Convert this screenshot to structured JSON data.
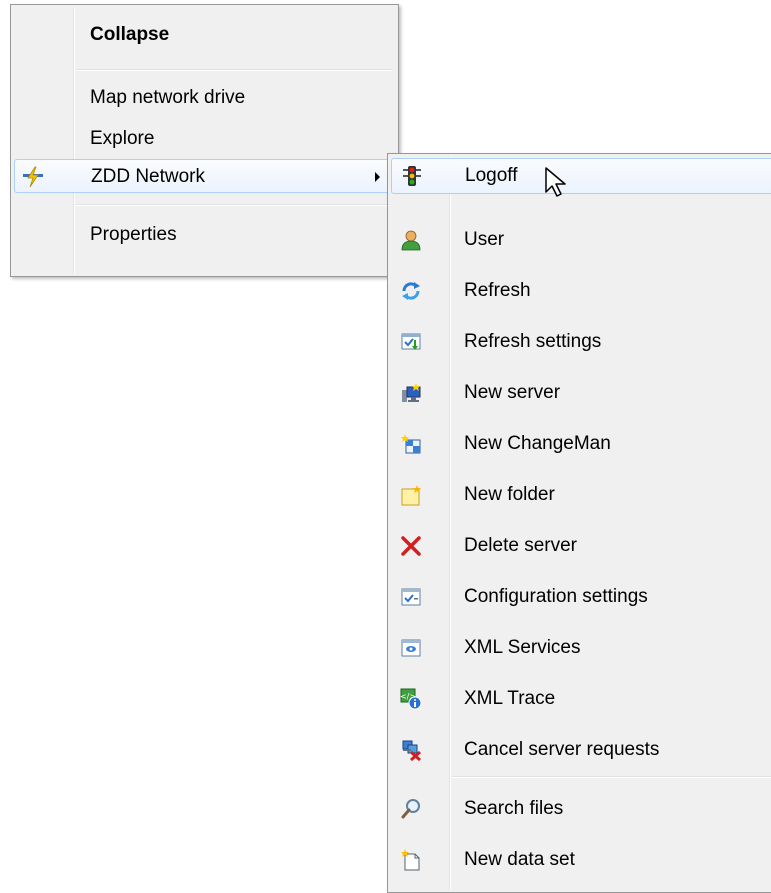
{
  "main_menu": {
    "items": [
      {
        "label": "Collapse",
        "bold": true
      },
      {
        "label": "Map network drive"
      },
      {
        "label": "Explore"
      },
      {
        "label": "ZDD Network",
        "icon": "zdd-network-icon",
        "submenu": true
      },
      {
        "label": "Properties"
      }
    ]
  },
  "sub_menu": {
    "items": [
      {
        "label": "Logoff",
        "icon": "traffic-light-icon",
        "highlighted": true
      },
      {
        "label": "User",
        "icon": "user-icon"
      },
      {
        "label": "Refresh",
        "icon": "refresh-icon"
      },
      {
        "label": "Refresh settings",
        "icon": "refresh-settings-icon"
      },
      {
        "label": "New server",
        "icon": "new-server-icon"
      },
      {
        "label": "New ChangeMan",
        "icon": "new-changeman-icon"
      },
      {
        "label": "New folder",
        "icon": "new-folder-icon"
      },
      {
        "label": "Delete server",
        "icon": "delete-icon"
      },
      {
        "label": "Configuration settings",
        "icon": "configuration-icon"
      },
      {
        "label": "XML Services",
        "icon": "xml-services-icon"
      },
      {
        "label": "XML Trace",
        "icon": "xml-trace-icon"
      },
      {
        "label": "Cancel server requests",
        "icon": "cancel-requests-icon"
      },
      {
        "label": "Search files",
        "icon": "search-icon"
      },
      {
        "label": "New data set",
        "icon": "new-data-set-icon"
      }
    ]
  },
  "colors": {
    "menu_bg": "#f0f0f0",
    "menu_border": "#979797",
    "hover_border": "#aecff7"
  }
}
